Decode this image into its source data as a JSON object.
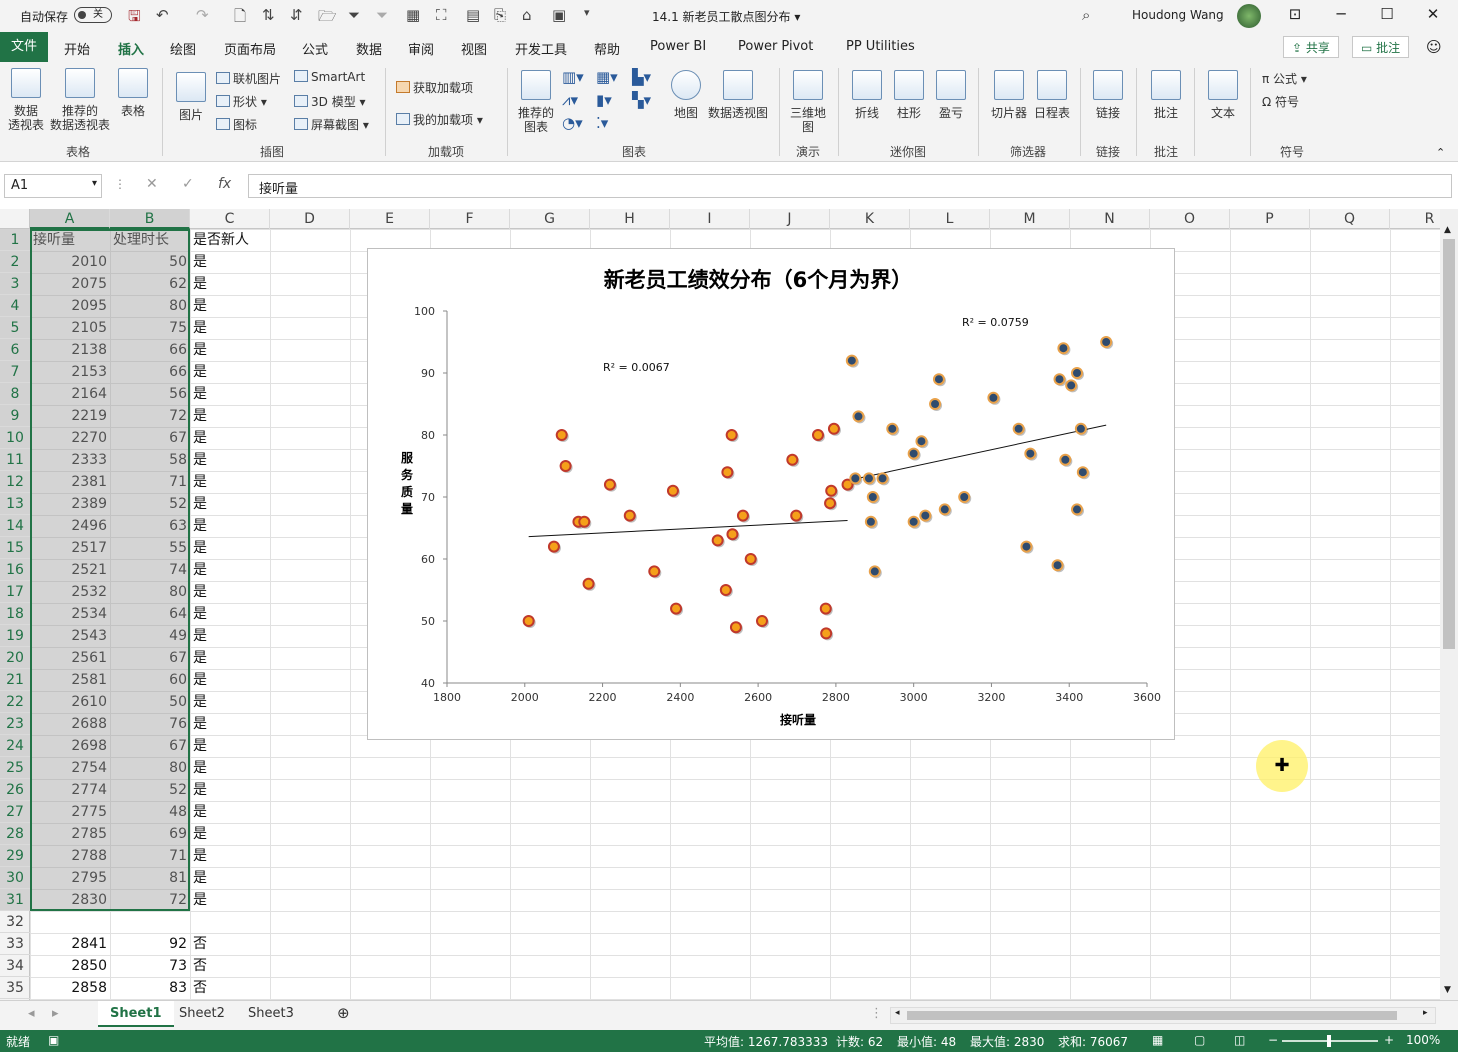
{
  "titlebar": {
    "autosave_label": "自动保存",
    "autosave_state": "关",
    "doc_title": "14.1 新老员工散点图分布 ▾",
    "user_name": "Houdong Wang"
  },
  "tabs": [
    "文件",
    "开始",
    "插入",
    "绘图",
    "页面布局",
    "公式",
    "数据",
    "审阅",
    "视图",
    "开发工具",
    "帮助",
    "Power BI",
    "Power Pivot",
    "PP Utilities"
  ],
  "active_tab": "插入",
  "share_label": "共享",
  "comment_label": "批注",
  "ribbon": {
    "tables": {
      "pivot": "数据\n透视表",
      "rec_pivot": "推荐的\n数据透视表",
      "table": "表格",
      "group": "表格"
    },
    "illus": {
      "picture": "图片",
      "online": "联机图片",
      "shapes": "形状",
      "icons": "图标",
      "smartart": "SmartArt",
      "model3d": "3D 模型",
      "screenshot": "屏幕截图",
      "group": "插图"
    },
    "addins": {
      "get": "获取加载项",
      "my": "我的加载项",
      "group": "加载项"
    },
    "charts": {
      "recommended": "推荐的\n图表",
      "map": "地图",
      "pivotchart": "数据透视图",
      "group": "图表"
    },
    "tours": {
      "map3d": "三维地\n图",
      "group": "演示"
    },
    "spark": {
      "line": "折线",
      "column": "柱形",
      "winloss": "盈亏",
      "group": "迷你图"
    },
    "filters": {
      "slicer": "切片器",
      "timeline": "日程表",
      "group": "筛选器"
    },
    "links": {
      "link": "链接",
      "group": "链接"
    },
    "comments": {
      "comment": "批注",
      "group": "批注"
    },
    "text": {
      "text": "文本"
    },
    "symbols": {
      "equation": "公式",
      "symbol": "符号",
      "group": "符号"
    }
  },
  "namebox": "A1",
  "formula": "接听量",
  "columns": [
    "A",
    "B",
    "C",
    "D",
    "E",
    "F",
    "G",
    "H",
    "I",
    "J",
    "K",
    "L",
    "M",
    "N",
    "O",
    "P",
    "Q",
    "R"
  ],
  "headers": [
    "接听量",
    "处理时长",
    "是否新人"
  ],
  "rows": [
    {
      "r": "1"
    },
    {
      "r": "2",
      "a": "2010",
      "b": "50",
      "c": "是"
    },
    {
      "r": "3",
      "a": "2075",
      "b": "62",
      "c": "是"
    },
    {
      "r": "4",
      "a": "2095",
      "b": "80",
      "c": "是"
    },
    {
      "r": "5",
      "a": "2105",
      "b": "75",
      "c": "是"
    },
    {
      "r": "6",
      "a": "2138",
      "b": "66",
      "c": "是"
    },
    {
      "r": "7",
      "a": "2153",
      "b": "66",
      "c": "是"
    },
    {
      "r": "8",
      "a": "2164",
      "b": "56",
      "c": "是"
    },
    {
      "r": "9",
      "a": "2219",
      "b": "72",
      "c": "是"
    },
    {
      "r": "10",
      "a": "2270",
      "b": "67",
      "c": "是"
    },
    {
      "r": "11",
      "a": "2333",
      "b": "58",
      "c": "是"
    },
    {
      "r": "12",
      "a": "2381",
      "b": "71",
      "c": "是"
    },
    {
      "r": "13",
      "a": "2389",
      "b": "52",
      "c": "是"
    },
    {
      "r": "14",
      "a": "2496",
      "b": "63",
      "c": "是"
    },
    {
      "r": "15",
      "a": "2517",
      "b": "55",
      "c": "是"
    },
    {
      "r": "16",
      "a": "2521",
      "b": "74",
      "c": "是"
    },
    {
      "r": "17",
      "a": "2532",
      "b": "80",
      "c": "是"
    },
    {
      "r": "18",
      "a": "2534",
      "b": "64",
      "c": "是"
    },
    {
      "r": "19",
      "a": "2543",
      "b": "49",
      "c": "是"
    },
    {
      "r": "20",
      "a": "2561",
      "b": "67",
      "c": "是"
    },
    {
      "r": "21",
      "a": "2581",
      "b": "60",
      "c": "是"
    },
    {
      "r": "22",
      "a": "2610",
      "b": "50",
      "c": "是"
    },
    {
      "r": "23",
      "a": "2688",
      "b": "76",
      "c": "是"
    },
    {
      "r": "24",
      "a": "2698",
      "b": "67",
      "c": "是"
    },
    {
      "r": "25",
      "a": "2754",
      "b": "80",
      "c": "是"
    },
    {
      "r": "26",
      "a": "2774",
      "b": "52",
      "c": "是"
    },
    {
      "r": "27",
      "a": "2775",
      "b": "48",
      "c": "是"
    },
    {
      "r": "28",
      "a": "2785",
      "b": "69",
      "c": "是"
    },
    {
      "r": "29",
      "a": "2788",
      "b": "71",
      "c": "是"
    },
    {
      "r": "30",
      "a": "2795",
      "b": "81",
      "c": "是"
    },
    {
      "r": "31",
      "a": "2830",
      "b": "72",
      "c": "是"
    },
    {
      "r": "32"
    },
    {
      "r": "33",
      "a": "2841",
      "b": "92",
      "c": "否"
    },
    {
      "r": "34",
      "a": "2850",
      "b": "73",
      "c": "否"
    },
    {
      "r": "35",
      "a": "2858",
      "b": "83",
      "c": "否"
    }
  ],
  "sheets": [
    "Sheet1",
    "Sheet2",
    "Sheet3"
  ],
  "status": {
    "ready": "就绪",
    "average": "平均值: 1267.783333",
    "count": "计数: 62",
    "min": "最小值: 48",
    "max": "最大值: 2830",
    "sum": "求和: 76067",
    "zoom": "100%"
  },
  "colors": {
    "accent": "#217346",
    "new_fill": "#f5a01a",
    "old_fill": "#2f4b6e",
    "marker_edge": "#c0392b"
  },
  "chart_data": {
    "type": "scatter",
    "title": "新老员工绩效分布（6个月为界）",
    "xlabel": "接听量",
    "ylabel": "服务质量",
    "xlim": [
      1800,
      3600
    ],
    "ylim": [
      40,
      100
    ],
    "xticks": [
      1800,
      2000,
      2200,
      2400,
      2600,
      2800,
      3000,
      3200,
      3400,
      3600
    ],
    "yticks": [
      40,
      50,
      60,
      70,
      80,
      90,
      100
    ],
    "series": [
      {
        "points": [
          [
            2010,
            50
          ],
          [
            2075,
            62
          ],
          [
            2095,
            80
          ],
          [
            2105,
            75
          ],
          [
            2138,
            66
          ],
          [
            2153,
            66
          ],
          [
            2164,
            56
          ],
          [
            2219,
            72
          ],
          [
            2270,
            67
          ],
          [
            2333,
            58
          ],
          [
            2381,
            71
          ],
          [
            2389,
            52
          ],
          [
            2496,
            63
          ],
          [
            2517,
            55
          ],
          [
            2521,
            74
          ],
          [
            2532,
            80
          ],
          [
            2534,
            64
          ],
          [
            2543,
            49
          ],
          [
            2561,
            67
          ],
          [
            2581,
            60
          ],
          [
            2610,
            50
          ],
          [
            2688,
            76
          ],
          [
            2698,
            67
          ],
          [
            2754,
            80
          ],
          [
            2774,
            52
          ],
          [
            2775,
            48
          ],
          [
            2785,
            69
          ],
          [
            2788,
            71
          ],
          [
            2795,
            81
          ],
          [
            2830,
            72
          ]
        ],
        "trend": [
          [
            2010,
            63.6
          ],
          [
            2830,
            66.2
          ]
        ],
        "r2_label": "R² = 0.0067"
      },
      {
        "points": [
          [
            2841,
            92
          ],
          [
            2850,
            73
          ],
          [
            2858,
            83
          ],
          [
            2885,
            73
          ],
          [
            2890,
            66
          ],
          [
            2895,
            70
          ],
          [
            2900,
            58
          ],
          [
            2920,
            73
          ],
          [
            2945,
            81
          ],
          [
            3000,
            66
          ],
          [
            3000,
            77
          ],
          [
            3020,
            79
          ],
          [
            3030,
            67
          ],
          [
            3055,
            85
          ],
          [
            3065,
            89
          ],
          [
            3080,
            68
          ],
          [
            3130,
            70
          ],
          [
            3205,
            86
          ],
          [
            3270,
            81
          ],
          [
            3290,
            62
          ],
          [
            3300,
            77
          ],
          [
            3370,
            59
          ],
          [
            3375,
            89
          ],
          [
            3385,
            94
          ],
          [
            3390,
            76
          ],
          [
            3405,
            88
          ],
          [
            3420,
            68
          ],
          [
            3420,
            90
          ],
          [
            3430,
            81
          ],
          [
            3435,
            74
          ],
          [
            3495,
            95
          ]
        ],
        "trend": [
          [
            2841,
            72.8
          ],
          [
            3495,
            81.6
          ]
        ],
        "r2_label": "R² = 0.0759"
      }
    ]
  }
}
